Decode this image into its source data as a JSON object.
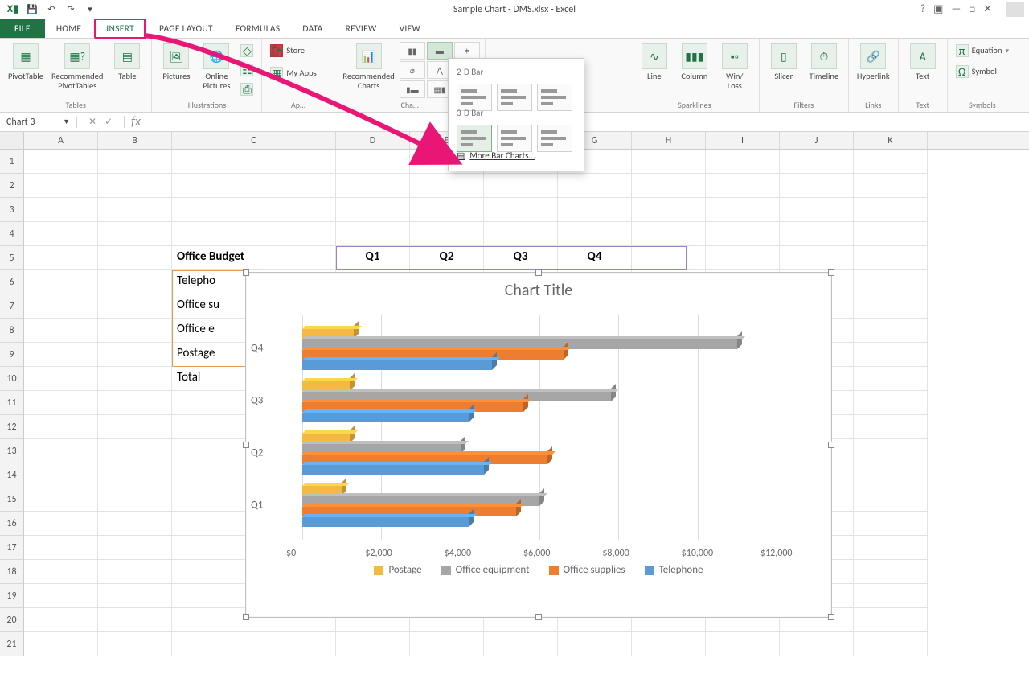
{
  "app": {
    "title": "Sample Chart - DMS.xlsx - Excel"
  },
  "qat": {
    "save": "💾",
    "undo": "↶",
    "redo": "↷"
  },
  "tabs": [
    "FILE",
    "HOME",
    "INSERT",
    "PAGE LAYOUT",
    "FORMULAS",
    "DATA",
    "REVIEW",
    "VIEW"
  ],
  "active_tab": "INSERT",
  "ribbon": {
    "tables": {
      "label": "Tables",
      "pivot": "PivotTable",
      "recpivot": "Recommended\nPivotTables",
      "table": "Table"
    },
    "illus": {
      "label": "Illustrations",
      "pics": "Pictures",
      "online": "Online\nPictures"
    },
    "apps": {
      "store": "Store",
      "myapps": "My Apps"
    },
    "charts": {
      "label": "Cha…",
      "rec": "Recommended\nCharts"
    },
    "spark": {
      "label": "Sparklines",
      "line": "Line",
      "col": "Column",
      "wl": "Win/\nLoss"
    },
    "filters": {
      "label": "Filters",
      "slicer": "Slicer",
      "timeline": "Timeline"
    },
    "links": {
      "label": "Links",
      "hyper": "Hyperlink"
    },
    "text": {
      "label": "Text",
      "text": "Text"
    },
    "symbols": {
      "label": "Symbols",
      "eq": "Equation",
      "sym": "Symbol"
    }
  },
  "bardrop": {
    "sect1": "2-D Bar",
    "sect2": "3-D Bar",
    "more": "More Bar Charts…"
  },
  "namebox": "Chart 3",
  "columns": [
    "A",
    "B",
    "C",
    "D",
    "E",
    "F",
    "G",
    "H",
    "I",
    "J",
    "K"
  ],
  "rownums": [
    1,
    2,
    3,
    4,
    5,
    6,
    7,
    8,
    9,
    10,
    11,
    12,
    13,
    14,
    15,
    16,
    17,
    18,
    19,
    20,
    21
  ],
  "cells": {
    "title": "Office Budget",
    "q": [
      "Q1",
      "Q2",
      "Q3",
      "Q4"
    ],
    "rows": [
      "Telepho",
      "Office su",
      "Office e",
      "Postage",
      "Total"
    ]
  },
  "chart": {
    "title": "Chart Title"
  },
  "chart_data": {
    "type": "bar",
    "orientation": "horizontal-3d",
    "categories": [
      "Q1",
      "Q2",
      "Q3",
      "Q4"
    ],
    "series": [
      {
        "name": "Postage",
        "color": "#f4b942",
        "values": [
          1000,
          1200,
          1200,
          1300
        ]
      },
      {
        "name": "Office equipment",
        "color": "#a6a6a6",
        "values": [
          6000,
          4000,
          7800,
          11000
        ]
      },
      {
        "name": "Office supplies",
        "color": "#ed7d31",
        "values": [
          5400,
          6200,
          5600,
          6600
        ]
      },
      {
        "name": "Telephone",
        "color": "#5b9bd5",
        "values": [
          4200,
          4600,
          4200,
          4800
        ]
      }
    ],
    "xlim": [
      0,
      12000
    ],
    "xticks": [
      "$0",
      "$2,000",
      "$4,000",
      "$6,000",
      "$8,000",
      "$10,000",
      "$12,000"
    ],
    "title": "Chart Title",
    "legend": [
      "Postage",
      "Office equipment",
      "Office supplies",
      "Telephone"
    ]
  }
}
